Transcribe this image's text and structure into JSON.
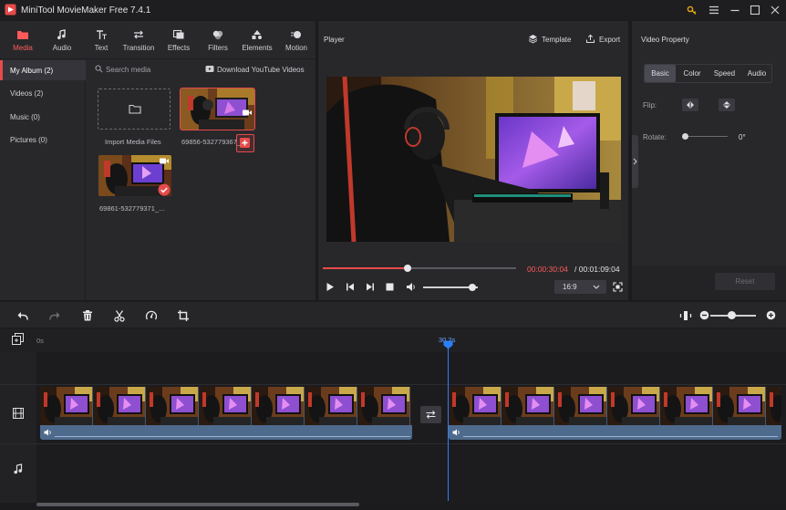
{
  "app": {
    "title": "MiniTool MovieMaker Free 7.4.1"
  },
  "toolbar": {
    "items": [
      {
        "label": "Media",
        "icon": "folder-icon"
      },
      {
        "label": "Audio",
        "icon": "music-note-icon"
      },
      {
        "label": "Text",
        "icon": "text-icon"
      },
      {
        "label": "Transition",
        "icon": "transition-icon"
      },
      {
        "label": "Effects",
        "icon": "effects-icon"
      },
      {
        "label": "Filters",
        "icon": "filters-icon"
      },
      {
        "label": "Elements",
        "icon": "elements-icon"
      },
      {
        "label": "Motion",
        "icon": "motion-icon"
      }
    ]
  },
  "albums": [
    {
      "label": "My Album (2)"
    },
    {
      "label": "Videos (2)"
    },
    {
      "label": "Music (0)"
    },
    {
      "label": "Pictures (0)"
    }
  ],
  "media": {
    "search_placeholder": "Search media",
    "youtube_label": "Download YouTube Videos",
    "import_label": "Import Media Files",
    "files": [
      {
        "name": "69856-532779367_..."
      },
      {
        "name": "69861-532779371_..."
      }
    ]
  },
  "player": {
    "title": "Player",
    "template_label": "Template",
    "export_label": "Export",
    "current_time": "00:00:30:04",
    "total_time": " / 00:01:09:04",
    "progress": 0.44,
    "volume": 0.9,
    "aspect": "16:9"
  },
  "properties": {
    "title": "Video Property",
    "tabs": [
      "Basic",
      "Color",
      "Speed",
      "Audio"
    ],
    "flip_label": "Flip:",
    "rotate_label": "Rotate:",
    "rotate_value": "0°",
    "reset_label": "Reset"
  },
  "timeline": {
    "ruler_start": "0s",
    "playhead_time": "30.2s",
    "zoom": 0.45
  },
  "colors": {
    "accent": "#e64a4a",
    "playhead": "#2b7fff",
    "clip": "#3f5a7a"
  }
}
